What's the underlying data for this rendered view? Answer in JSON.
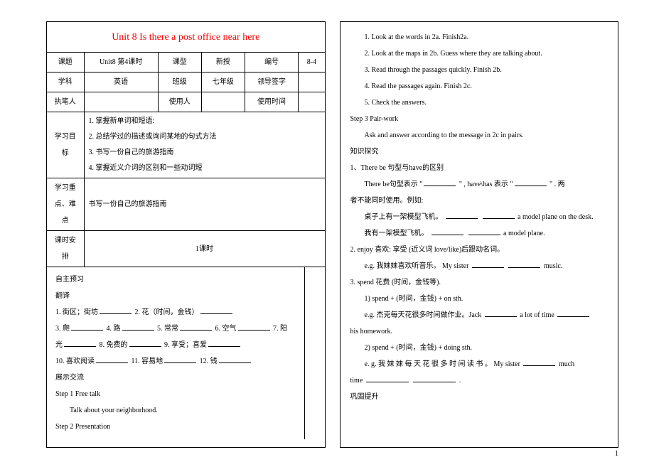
{
  "title": "Unit 8 Is there a post office near here",
  "info": {
    "r1c1": "课题",
    "r1c2": "Unit8 第4课时",
    "r1c3": "课型",
    "r1c4": "新授",
    "r1c5": "编号",
    "r1c6": "8-4",
    "r2c1": "学科",
    "r2c2": "英语",
    "r2c3": "班级",
    "r2c4": "七年级",
    "r2c5": "领导签字",
    "r2c6": "",
    "r3c1": "执笔人",
    "r3c2": "",
    "r3c3": "使用人",
    "r3c4": "",
    "r3c5": "使用时间",
    "r3c6": ""
  },
  "goal_label": "学习目标",
  "goals": {
    "g1": "1. 掌握新单词和短语:",
    "g2": "2. 总结学过的描述或询问某地的句式方法",
    "g3": "3. 书写一份自己的旅游指南",
    "g4": "4. 掌握近义介词的区别和一些动词短"
  },
  "focus_label": "学习重点、难点",
  "focus_text": "书写一份自己的旅游指南",
  "period_label": "课时安排",
  "period_text": "1课时",
  "pre": {
    "h1": "自主预习",
    "h2": "翻译",
    "l1a": "1. 街区；街坊",
    "l1b": "2. 花（时间，金钱）",
    "l2a": "3. 爬",
    "l2b": "4. 路",
    "l2c": "5. 常常",
    "l2d": "6. 空气",
    "l2e": "7. 阳",
    "l3a": "光",
    "l3b": "8. 免费的",
    "l3c": "9. 享受；喜爱",
    "l4a": "10. 喜欢阅读",
    "l4b": "11. 容易地",
    "l4c": "12. 钱",
    "h3": "展示交流",
    "s1": "Step 1  Free talk",
    "s1a": "Talk about your neighborhood.",
    "s2": "Step 2 Presentation"
  },
  "right": {
    "p1": "1. Look at the words in 2a. Finish2a.",
    "p2": "2. Look at the maps in 2b. Guess where they are talking about.",
    "p3": "3. Read through the passages quickly. Finish 2b.",
    "p4": "4. Read the passages again. Finish 2c.",
    "p5": "5. Check the answers.",
    "s3": "Step 3  Pair-work",
    "s3a": "Ask and answer according to the message in 2c in pairs.",
    "h4": "知识探究",
    "k1": "1、There be 句型与have的区别",
    "k1a_a": "There be句型表示 \"",
    "k1a_b": "\" , have\\has 表示 \"",
    "k1a_c": "\" . 两",
    "k1b": "者不能同时使用。例如:",
    "k1c_a": "桌子上有一架模型飞机。",
    "k1c_b": "a model plane on the desk.",
    "k1d_a": "我有一架模型飞机。",
    "k1d_b": "a model plane.",
    "k2": "2. enjoy 喜欢: 享受 (近义词 love/like)后跟动名词。",
    "k2a_a": "e.g. 我妹妹喜欢听音乐。 My sister",
    "k2a_b": "music.",
    "k3": "3. spend 花费 (时间，金钱等).",
    "k3a": "1) spend + (时间，金钱) + on sth.",
    "k3b_a": "e.g. 杰克每天花很多时间做作业。Jack",
    "k3b_b": "a lot of time",
    "k3c": "his homework.",
    "k3d": "2) spend + (时间，金钱) + doing sth.",
    "k3e_a": "e. g.  我 妹 妹 每 天 花 很 多 时 间 读 书 。  My sister",
    "k3e_b": "much",
    "k3f_a": "time",
    "k3f_b": ".",
    "h5": "巩固提升"
  },
  "pagenum": "1"
}
